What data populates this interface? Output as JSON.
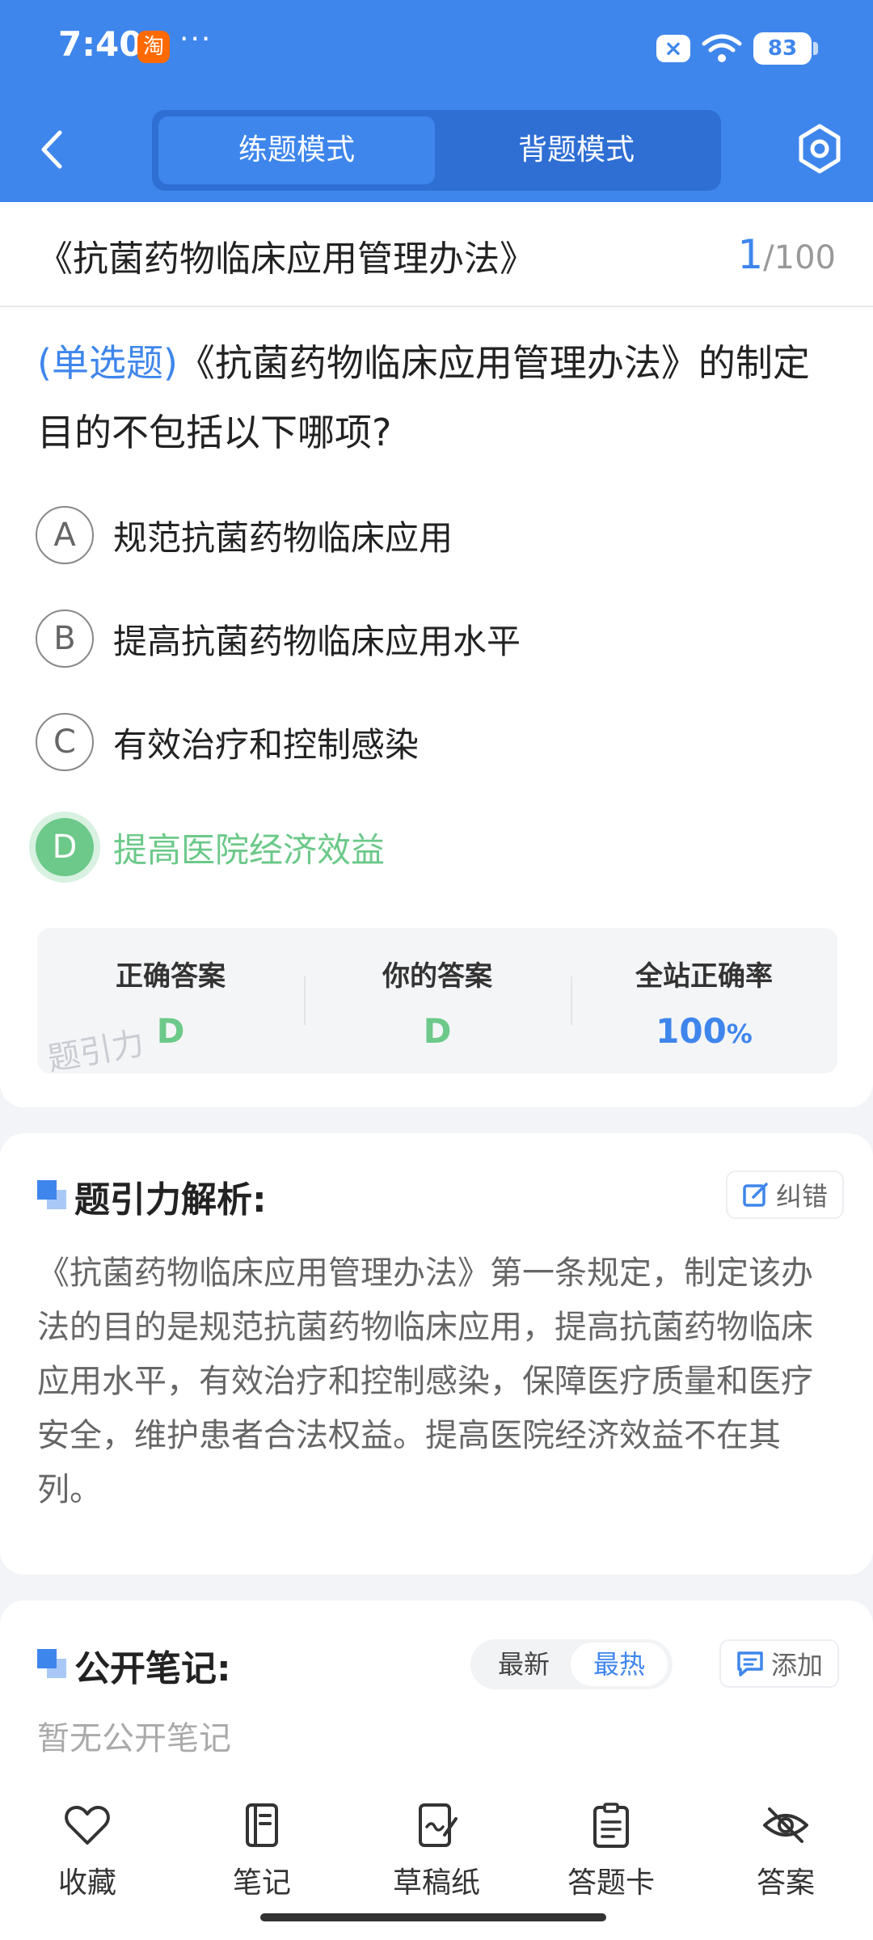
{
  "status_bar": {
    "time": "7:40",
    "taobao_glyph": "淘",
    "dots": "···",
    "notif_x": "×",
    "battery": "83"
  },
  "header": {
    "tabs": {
      "practice": "练题模式",
      "memorize": "背题模式"
    }
  },
  "title_bar": {
    "title": "《抗菌药物临床应用管理办法》",
    "current": "1",
    "total": "/100"
  },
  "question": {
    "type": "(单选题)",
    "text": "《抗菌药物临床应用管理办法》的制定目的不包括以下哪项?",
    "options": [
      {
        "letter": "A",
        "text": "规范抗菌药物临床应用"
      },
      {
        "letter": "B",
        "text": "提高抗菌药物临床应用水平"
      },
      {
        "letter": "C",
        "text": "有效治疗和控制感染"
      },
      {
        "letter": "D",
        "text": "提高医院经济效益"
      }
    ],
    "answer_box": {
      "correct_label": "正确答案",
      "correct_value": "D",
      "yours_label": "你的答案",
      "yours_value": "D",
      "rate_label": "全站正确率",
      "rate_value": "100",
      "rate_unit": "%",
      "watermark": "题引力"
    }
  },
  "analysis": {
    "title": "题引力解析:",
    "report_label": "纠错",
    "body": "《抗菌药物临床应用管理办法》第一条规定，制定该办法的目的是规范抗菌药物临床应用，提高抗菌药物临床应用水平，有效治疗和控制感染，保障医疗质量和医疗安全，维护患者合法权益。提高医院经济效益不在其列。"
  },
  "notes": {
    "title": "公开笔记:",
    "sort_latest": "最新",
    "sort_hot": "最热",
    "add_label": "添加",
    "empty": "暂无公开笔记"
  },
  "toolbar": {
    "favorite": "收藏",
    "notes": "笔记",
    "scratch": "草稿纸",
    "answer_card": "答题卡",
    "answer": "答案"
  },
  "colors": {
    "brand": "#3f86ec",
    "correct": "#6cc989"
  }
}
